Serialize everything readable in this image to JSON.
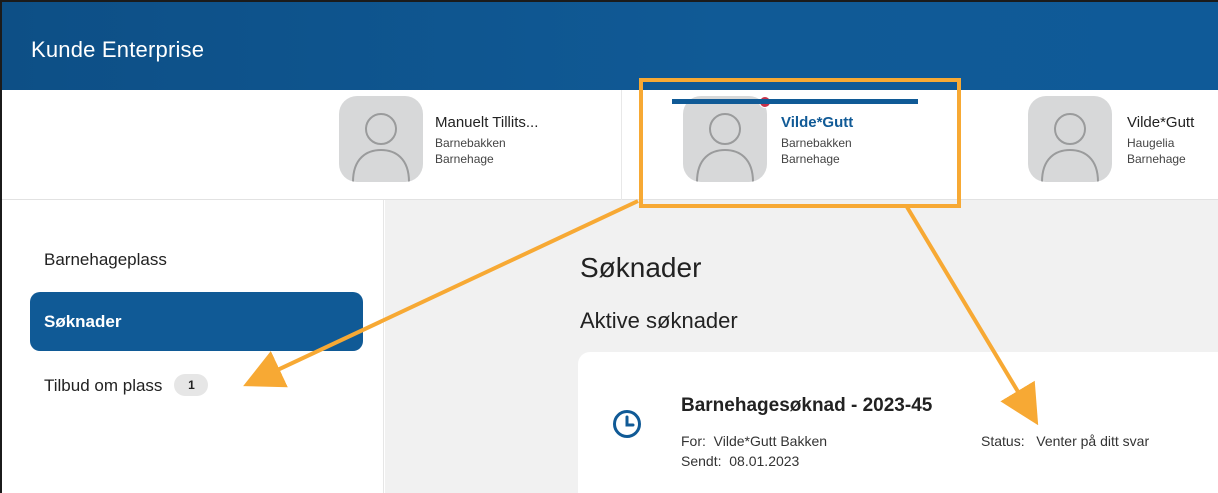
{
  "app": {
    "title": "Kunde Enterprise"
  },
  "profiles": [
    {
      "name": "Manuelt Tillits...",
      "line1": "Barnebakken",
      "line2": "Barnehage",
      "active": false
    },
    {
      "name": "Vilde*Gutt",
      "line1": "Barnebakken",
      "line2": "Barnehage",
      "active": true,
      "notification": true
    },
    {
      "name": "Vilde*Gutt",
      "line1": "Haugelia",
      "line2": "Barnehage",
      "active": false
    }
  ],
  "sidebar": {
    "items": [
      {
        "label": "Barnehageplass"
      },
      {
        "label": "Søknader"
      },
      {
        "label": "Tilbud om plass",
        "badge": "1"
      }
    ]
  },
  "main": {
    "title": "Søknader",
    "subtitle": "Aktive søknader",
    "application": {
      "title": "Barnehagesøknad - 2023-45",
      "for_label": "For:",
      "for_value": "Vilde*Gutt Bakken",
      "sent_label": "Sendt:",
      "sent_value": "08.01.2023",
      "status_label": "Status:",
      "status_value": "Venter på ditt svar"
    }
  },
  "colors": {
    "brand": "#105a96",
    "highlight": "#f7a934",
    "notification": "#c8324a"
  }
}
